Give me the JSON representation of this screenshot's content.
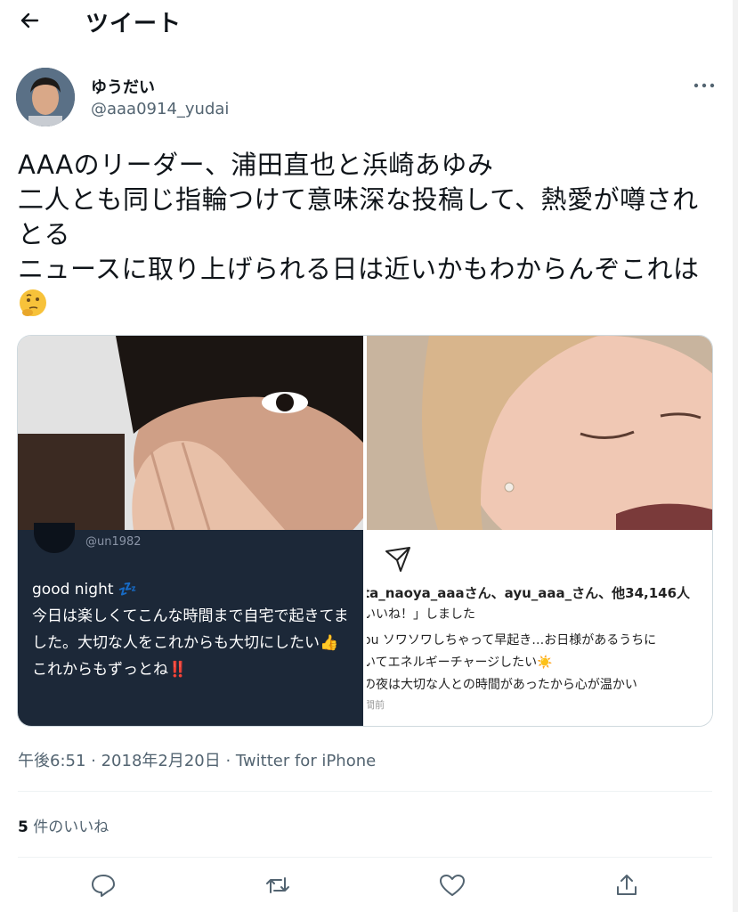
{
  "header": {
    "back_icon": "arrow-left-icon",
    "title": "ツイート"
  },
  "author": {
    "display_name": "ゆうだい",
    "handle": "@aaa0914_yudai",
    "more_icon": "more-dots-icon"
  },
  "tweet": {
    "text": "AAAのリーダー、浦田直也と浜崎あゆみ\n二人とも同じ指輪つけて意味深な投稿して、熱愛が噂されとる\nニュースに取り上げられる日は近いかもわからんぞこれは",
    "emoji": "thinking-face-icon"
  },
  "media": {
    "left": {
      "insta_handle": "@un1982",
      "post_text": "good night 💤\n今日は楽しくてこんな時間まで自宅で起きてました。大切な人をこれからも大切にしたい👍これからもずっとね‼️"
    },
    "right": {
      "likes_line": "ta_naoya_aaaさん、ayu_aaa_さん、他34,146人",
      "likes_line2": "いいね！」しました",
      "caption": "ou ソワソワしちゃって早起き…お日様があるうちに\nいてエネルギーチャージしたい☀️\nの夜は大切な人との時間があったから心が温かい",
      "time": "間前"
    }
  },
  "meta": {
    "timestamp": "午後6:51 · 2018年2月20日 · Twitter for iPhone"
  },
  "engagement": {
    "likes_count": "5",
    "likes_label": "件のいいね"
  },
  "actions": [
    "reply-icon",
    "retweet-icon",
    "like-icon",
    "share-icon"
  ],
  "colors": {
    "text": "#0f1419",
    "secondary": "#536471",
    "border": "#cfd9de"
  }
}
